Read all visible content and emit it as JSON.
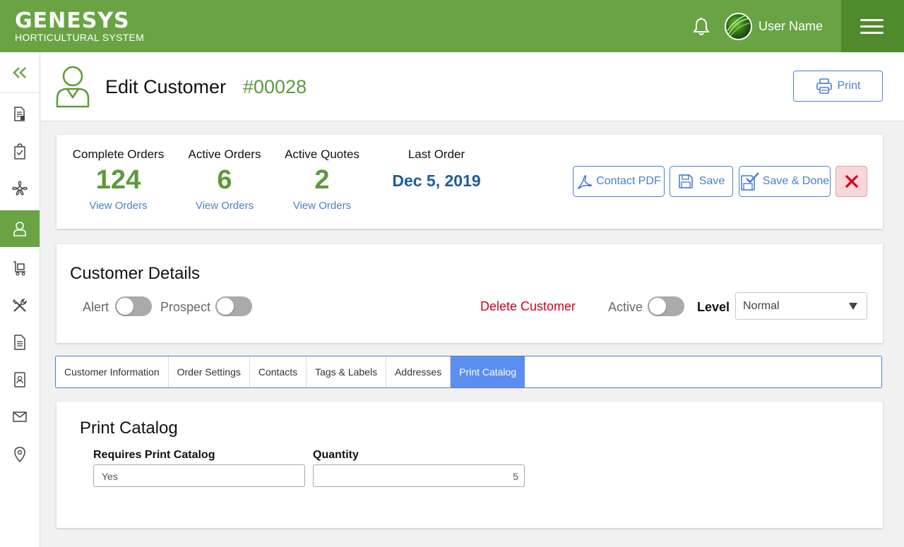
{
  "brand": {
    "name": "GENESYS",
    "subtitle": "HORTICULTURAL SYSTEM",
    "accent": "#6aa343",
    "link": "#4a7fd1",
    "danger": "#d0021b"
  },
  "user": {
    "name": "User Name"
  },
  "sidebar": {
    "items": [
      {
        "icon": "chevrons-left-icon"
      },
      {
        "icon": "document-list-icon"
      },
      {
        "icon": "clipboard-check-icon"
      },
      {
        "icon": "plant-icon"
      },
      {
        "icon": "customer-icon",
        "active": true
      },
      {
        "icon": "cart-icon"
      },
      {
        "icon": "tools-icon"
      },
      {
        "icon": "document-icon"
      },
      {
        "icon": "contact-book-icon"
      },
      {
        "icon": "mail-icon"
      },
      {
        "icon": "location-pin-icon"
      }
    ]
  },
  "header": {
    "title": "Edit Customer",
    "customer_id": "#00028",
    "print_label": "Print"
  },
  "stats": {
    "complete_orders": {
      "label": "Complete Orders",
      "value": "124",
      "link": "View Orders"
    },
    "active_orders": {
      "label": "Active Orders",
      "value": "6",
      "link": "View Orders"
    },
    "active_quotes": {
      "label": "Active Quotes",
      "value": "2",
      "link": "View Orders"
    },
    "last_order": {
      "label": "Last Order",
      "value": "Dec 5, 2019"
    }
  },
  "actions": {
    "contact_pdf": "Contact PDF",
    "save": "Save",
    "save_done": "Save & Done"
  },
  "details": {
    "title": "Customer Details",
    "alert_label": "Alert",
    "alert_on": false,
    "prospect_label": "Prospect",
    "prospect_on": false,
    "delete_label": "Delete Customer",
    "active_label": "Active",
    "active_on": false,
    "level_label": "Level",
    "level_value": "Normal"
  },
  "tabs": [
    {
      "label": "Customer Information"
    },
    {
      "label": "Order Settings"
    },
    {
      "label": "Contacts"
    },
    {
      "label": "Tags & Labels"
    },
    {
      "label": "Addresses"
    },
    {
      "label": "Print Catalog",
      "active": true
    }
  ],
  "catalog": {
    "title": "Print Catalog",
    "requires_label": "Requires Print Catalog",
    "requires_value": "Yes",
    "quantity_label": "Quantity",
    "quantity_value": "5"
  }
}
